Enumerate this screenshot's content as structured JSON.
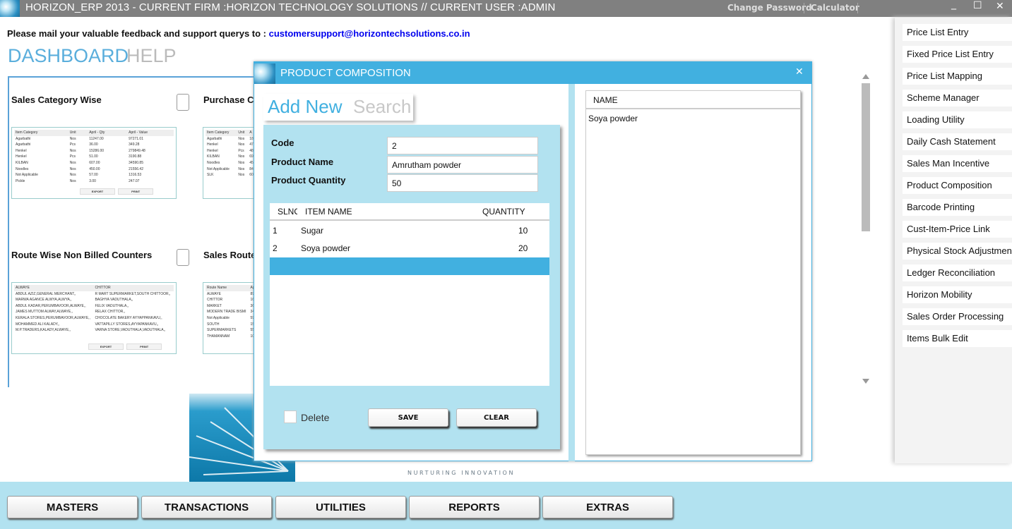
{
  "window": {
    "title": "HORIZON_ERP 2013 - CURRENT FIRM :HORIZON TECHNOLOGY SOLUTIONS // CURRENT USER :ADMIN",
    "change_password": "Change Password",
    "calculator": "Calculator",
    "minimize": "_",
    "maximize": "☐",
    "close": "✕"
  },
  "feedback": {
    "text": "Please mail your valuable feedback and support querys to : ",
    "email": "customersupport@horizontechsolutions.co.in"
  },
  "top_tabs": {
    "dashboard": "DASHBOARD",
    "help": "HELP"
  },
  "dashboard": {
    "widgets": [
      {
        "title": "Sales Category Wise",
        "headers": [
          "Item Category",
          "Unit",
          "April - Qty",
          "April - Value"
        ],
        "rows": [
          [
            "Agarbathi",
            "Nos",
            "11247.00",
            "97271.01"
          ],
          [
            "Agarbathi",
            "Pcs",
            "36.00",
            "349.28"
          ],
          [
            "Henkel",
            "Nos",
            "15286.00",
            "279849.48"
          ],
          [
            "Henkel",
            "Pcs",
            "51.00",
            "3190.88"
          ],
          [
            "KILBAN",
            "Nos",
            "607.00",
            "34590.85"
          ],
          [
            "Noodles",
            "Nos",
            "450.00",
            "21556.42"
          ],
          [
            "Not Applicable",
            "Nos",
            "57.00",
            "1316.53"
          ],
          [
            "Pickle",
            "Nos",
            "3.00",
            "247.07"
          ]
        ],
        "export": "EXPORT",
        "print": "PRINT"
      },
      {
        "title": "Purchase Ca",
        "headers": [
          "Item Category",
          "Unit",
          "A"
        ],
        "rows": [
          [
            "Agarbathi",
            "Nos",
            "18"
          ],
          [
            "Henkel",
            "Nos",
            "47"
          ],
          [
            "Henkel",
            "Pcs",
            "48"
          ],
          [
            "KILBAN",
            "Nos",
            "69"
          ],
          [
            "Noodles",
            "Nos",
            "45"
          ],
          [
            "Not Applicable",
            "Nos",
            "84"
          ],
          [
            "SLK",
            "Nos",
            "60"
          ]
        ]
      },
      {
        "title": "Route Wise Non Billed Counters",
        "headers": [
          "ALWAYE",
          "CHITTOR"
        ],
        "rows": [
          [
            "ABDUL AZIZ,GENERAL MERCHANT,,",
            "R MART SUPERMARKET,SOUTH CHITTOOR,,"
          ],
          [
            "MARWA AGANCE ALWYA,ALWYA,,",
            "BAGHYA VADUTHALA,,"
          ],
          [
            "ABDUL KADAR,PERUMBAVOOR,ALWAYE,,",
            "FELIX  VADUTHALA,,"
          ],
          [
            "JAMES MUTTOM ALWAY,ALWAYE,,",
            "RELAX CHITTOR,,"
          ],
          [
            "KERALA STORES,PERUMBAVOOR,ALWAYE,,",
            "CHOCOLATE BAKERY AYYAPPANKAVU,,"
          ],
          [
            "MOHAMMED ALI KALADY,,",
            "VATTAPILLY STORES,AYYAPANKAVU,,"
          ],
          [
            "M.P.TRADERS,KALADY,ALWAYE,,",
            "VARNA STORE,VADUTHALA,VADUTHALA,,"
          ]
        ],
        "export": "EXPORT",
        "print": "PRINT"
      },
      {
        "title": "Sales Route",
        "headers": [
          "Route Name",
          "Ap"
        ],
        "rows": [
          [
            "ALWAYE",
            "89"
          ],
          [
            "CHITTOR",
            "16"
          ],
          [
            "MARKET",
            "36"
          ],
          [
            "MODERN TRADE BISMI",
            "34"
          ],
          [
            "Not Applicable",
            "59"
          ],
          [
            "SOUTH",
            "15"
          ],
          [
            "SUPERMARKETS",
            "55"
          ],
          [
            "THAMANNAM",
            "10"
          ]
        ]
      }
    ]
  },
  "tagline": "NURTURING INNOVATION",
  "bottom_menu": [
    "MASTERS",
    "TRANSACTIONS",
    "UTILITIES",
    "REPORTS",
    "EXTRAS"
  ],
  "sidebar": {
    "items": [
      "Price List Entry",
      "Fixed Price List Entry",
      "Price List Mapping",
      "Scheme Manager",
      "Loading Utility",
      "Daily Cash Statement",
      "Sales Man Incentive",
      "Product Composition",
      "Barcode Printing",
      "Cust-Item-Price Link",
      "Physical Stock Adjustment",
      "Ledger Reconciliation",
      "Horizon Mobility",
      "Sales Order Processing",
      "Items Bulk Edit"
    ]
  },
  "dialog": {
    "title": "PRODUCT COMPOSITION",
    "close": "✕",
    "tabs": {
      "add_new": "Add New",
      "search": "Search"
    },
    "form": {
      "code_label": "Code",
      "code": "2",
      "name_label": "Product Name",
      "name": "Amrutham powder",
      "qty_label": "Product Quantity",
      "qty": "50"
    },
    "grid": {
      "headers": [
        "SLNO",
        "ITEM NAME",
        "QUANTITY"
      ],
      "rows": [
        [
          "1",
          "Sugar",
          "10"
        ],
        [
          "2",
          "Soya powder",
          "20"
        ]
      ]
    },
    "delete_label": "Delete",
    "save": "SAVE",
    "clear": "CLEAR",
    "right_grid": {
      "header": "NAME",
      "rows": [
        "Soya powder"
      ]
    },
    "accent": "#41b0e0",
    "panel": "#b2e2f0"
  }
}
